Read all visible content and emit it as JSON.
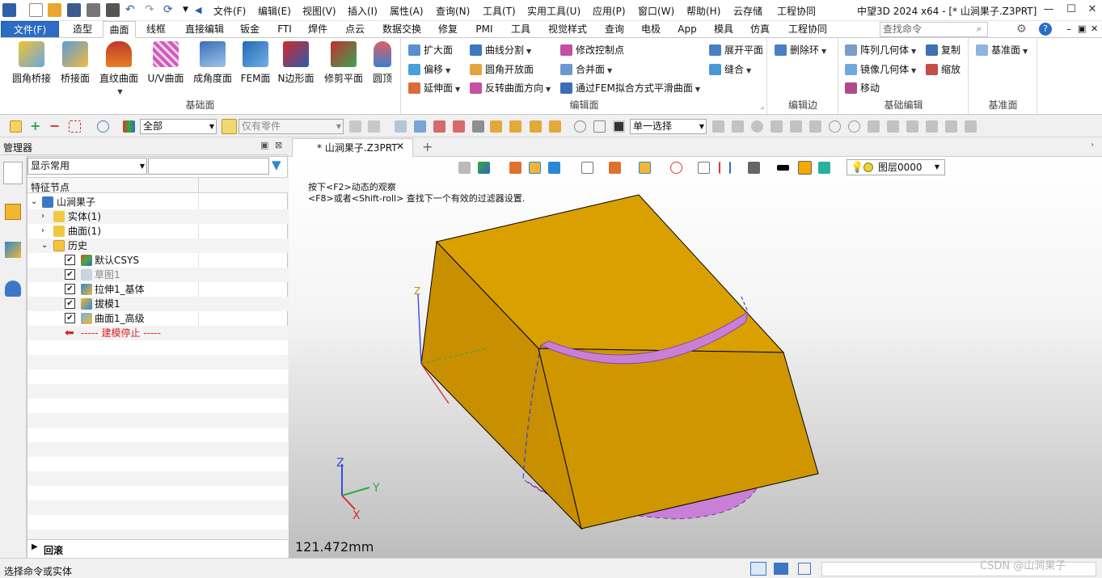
{
  "title_bar": {
    "menus": [
      "文件(F)",
      "编辑(E)",
      "视图(V)",
      "插入(I)",
      "属性(A)",
      "查询(N)",
      "工具(T)",
      "实用工具(U)",
      "应用(P)",
      "窗口(W)",
      "帮助(H)",
      "云存储",
      "工程协同"
    ],
    "app_title": "中望3D 2024 x64 - [* 山涧果子.Z3PRT]"
  },
  "ribbon_tabs": [
    "文件(F)",
    "造型",
    "曲面",
    "线框",
    "直接编辑",
    "钣金",
    "FTI",
    "焊件",
    "点云",
    "数据交换",
    "修复",
    "PMI",
    "工具",
    "视觉样式",
    "查询",
    "电极",
    "App",
    "模具",
    "仿真",
    "工程协同"
  ],
  "active_tab": "曲面",
  "search_placeholder": "查找命令",
  "ribbon": {
    "basic_surface": {
      "title": "基础面",
      "buttons": [
        "圆角桥接",
        "桥接面",
        "直纹曲面",
        "U/V曲面",
        "成角度面",
        "FEM面",
        "N边形面",
        "修剪平面",
        "圆顶"
      ]
    },
    "edit_surface": {
      "title": "编辑面",
      "col1": [
        "扩大面",
        "偏移",
        "延伸面"
      ],
      "col2": [
        "曲线分割",
        "圆角开放面",
        "反转曲面方向"
      ],
      "col3": [
        "修改控制点",
        "合并面",
        "通过FEM拟合方式平滑曲面"
      ],
      "col4": [
        "展开平面",
        "缝合"
      ]
    },
    "edit_edge": {
      "title": "编辑边",
      "button": "删除环"
    },
    "basic_edit": {
      "title": "基础编辑",
      "col1": [
        "阵列几何体",
        "镜像几何体",
        "移动"
      ],
      "col2": [
        "复制",
        "缩放"
      ]
    },
    "datum": {
      "title": "基准面",
      "button": "基准面"
    }
  },
  "toolbar": {
    "filter_value": "全部",
    "part_filter": "仅有零件",
    "select_mode": "单一选择"
  },
  "manager": {
    "title": "管理器",
    "display_combo": "显示常用",
    "column_header": "特征节点",
    "tree": [
      {
        "label": "山涧果子",
        "level": 0
      },
      {
        "label": "实体(1)",
        "level": 1
      },
      {
        "label": "曲面(1)",
        "level": 1
      },
      {
        "label": "历史",
        "level": 1
      },
      {
        "label": "默认CSYS",
        "level": 2
      },
      {
        "label": "草图1",
        "level": 2
      },
      {
        "label": "拉伸1_基体",
        "level": 2
      },
      {
        "label": "拔模1",
        "level": 2
      },
      {
        "label": "曲面1_高级",
        "level": 2
      },
      {
        "label": "----- 建模停止 -----",
        "level": 2
      }
    ],
    "rollback_label": "回滚"
  },
  "document_tab": "* 山涧果子.Z3PRT",
  "viewport": {
    "hint1": "按下<F2>动态的观察",
    "hint2": "<F8>或者<Shift-roll> 查找下一个有效的过滤器设置.",
    "layer": "图层0000",
    "dimension": "121.472mm",
    "axis_x": "X",
    "axis_y": "Y",
    "axis_z": "Z"
  },
  "status_text": "选择命令或实体",
  "watermark": "CSDN @山涧果子",
  "colors": {
    "accent": "#2b6cc4",
    "solid": "#d49a00",
    "surface": "#c77fd6"
  }
}
